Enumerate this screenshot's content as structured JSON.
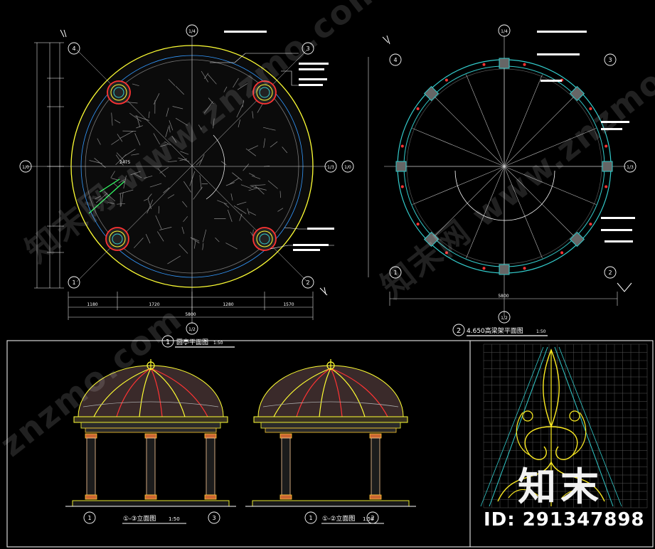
{
  "titles": {
    "plan_left_num": "1",
    "plan_left_title": "圆亭平面图",
    "plan_left_scale": "1:50",
    "plan_right_num": "2",
    "plan_right_title": "4.650高梁架平面图",
    "plan_right_scale": "1:50",
    "elev_left_title": "①-③立面图",
    "elev_left_scale": "1:50",
    "elev_right_title": "①-②立面图",
    "elev_right_scale": "1:50"
  },
  "axes": {
    "a1": "1",
    "a2": "2",
    "a3": "3",
    "a4": "4",
    "a14": "1/4",
    "a13": "1/3",
    "a12": "1/2",
    "a10": "1/0"
  },
  "dims": {
    "left_bottom": [
      "1180",
      "1720",
      "1280",
      "1570"
    ],
    "left_total": "5800",
    "right_total": "5800",
    "radius": "2475"
  },
  "colors": {
    "bg": "#000000",
    "frame": "#ffffff",
    "yellow": "#ffff33",
    "cyan": "#33cccc",
    "red": "#ff3333",
    "green": "#33ff66",
    "magenta": "#cc33cc",
    "white": "#ffffff"
  },
  "watermarks": [
    "知末网 www.znzmo.com",
    "znzmo.com",
    "知末网 www.znzmo.com"
  ],
  "brand": {
    "logo": "知末",
    "id": "ID: 291347898"
  }
}
